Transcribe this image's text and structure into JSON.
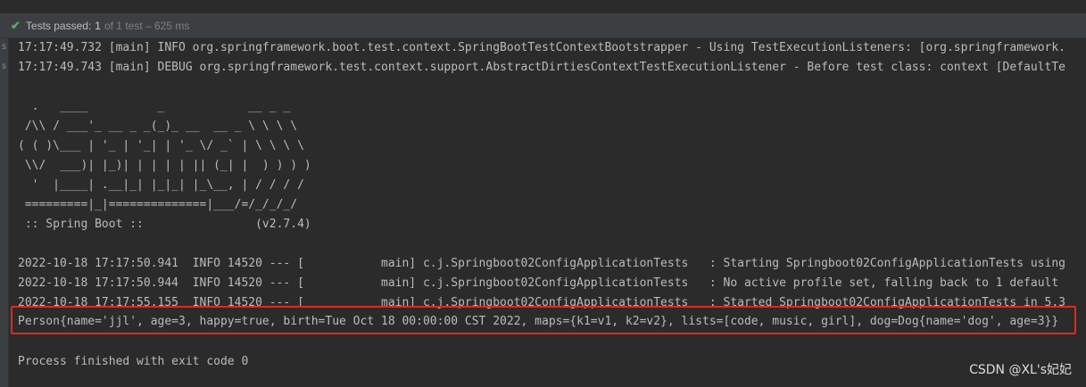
{
  "status": {
    "icon": "check-icon",
    "label": "Tests passed:",
    "count": "1",
    "rest": "of 1 test – 625 ms"
  },
  "gutter": {
    "marks": [
      "s",
      "s"
    ]
  },
  "console": {
    "lines": [
      "17:17:49.732 [main] INFO org.springframework.boot.test.context.SpringBootTestContextBootstrapper - Using TestExecutionListeners: [org.springframework.",
      "17:17:49.743 [main] DEBUG org.springframework.test.context.support.AbstractDirtiesContextTestExecutionListener - Before test class: context [DefaultTe",
      "",
      "  .   ____          _            __ _ _",
      " /\\\\ / ___'_ __ _ _(_)_ __  __ _ \\ \\ \\ \\",
      "( ( )\\___ | '_ | '_| | '_ \\/ _` | \\ \\ \\ \\",
      " \\\\/  ___)| |_)| | | | | || (_| |  ) ) ) )",
      "  '  |____| .__|_| |_|_| |_\\__, | / / / /",
      " =========|_|==============|___/=/_/_/_/",
      " :: Spring Boot ::                (v2.7.4)",
      "",
      "2022-10-18 17:17:50.941  INFO 14520 --- [           main] c.j.Springboot02ConfigApplicationTests   : Starting Springboot02ConfigApplicationTests using",
      "2022-10-18 17:17:50.944  INFO 14520 --- [           main] c.j.Springboot02ConfigApplicationTests   : No active profile set, falling back to 1 default",
      "2022-10-18 17:17:55.155  INFO 14520 --- [           main] c.j.Springboot02ConfigApplicationTests   : Started Springboot02ConfigApplicationTests in 5.3",
      "Person{name='jjl', age=3, happy=true, birth=Tue Oct 18 00:00:00 CST 2022, maps={k1=v1, k2=v2}, lists=[code, music, girl], dog=Dog{name='dog', age=3}}",
      "",
      "Process finished with exit code 0"
    ]
  },
  "watermark": "CSDN @XL's妃妃",
  "colors": {
    "background": "#2b2b2b",
    "console_text": "#bbbbbb",
    "pass_green": "#59a869",
    "highlight_red": "#e8251c"
  }
}
